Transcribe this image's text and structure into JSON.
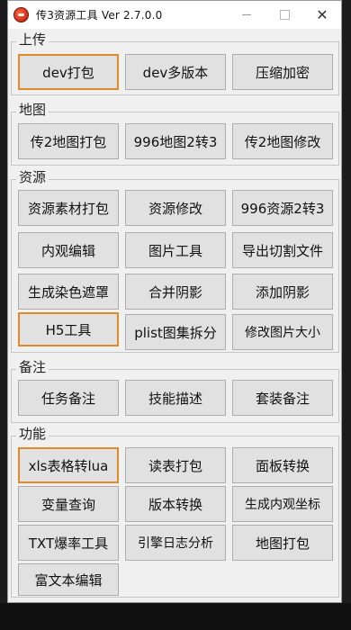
{
  "window": {
    "title": "传3资源工具 Ver 2.7.0.0"
  },
  "groups": {
    "upload": {
      "title": "上传",
      "buttons": [
        "dev打包",
        "dev多版本",
        "压缩加密"
      ]
    },
    "map": {
      "title": "地图",
      "buttons": [
        "传2地图打包",
        "996地图2转3",
        "传2地图修改"
      ]
    },
    "resource": {
      "title": "资源",
      "buttons": [
        "资源素材打包",
        "资源修改",
        "996资源2转3",
        "内观编辑",
        "图片工具",
        "导出切割文件",
        "生成染色遮罩",
        "合并阴影",
        "添加阴影",
        "H5工具",
        "plist图集拆分",
        "修改图片大小"
      ]
    },
    "notes": {
      "title": "备注",
      "buttons": [
        "任务备注",
        "技能描述",
        "套装备注"
      ]
    },
    "functions": {
      "title": "功能",
      "buttons": [
        "xls表格转lua",
        "读表打包",
        "面板转换",
        "变量查询",
        "版本转换",
        "生成内观坐标",
        "TXT爆率工具",
        "引擎日志分析",
        "地图打包",
        "富文本编辑"
      ]
    }
  }
}
